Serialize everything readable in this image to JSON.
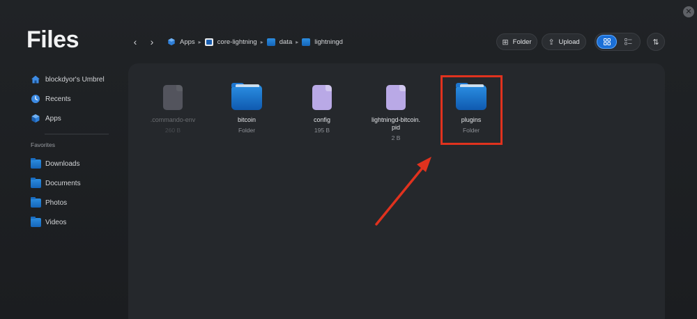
{
  "app": {
    "title": "Files"
  },
  "window": {
    "close_icon": "close-icon"
  },
  "sidebar": {
    "items": [
      {
        "label": "blockdyor's Umbrel",
        "icon": "home-icon"
      },
      {
        "label": "Recents",
        "icon": "clock-icon"
      },
      {
        "label": "Apps",
        "icon": "cube-icon"
      }
    ],
    "favorites_heading": "Favorites",
    "favorites": [
      {
        "label": "Downloads",
        "icon": "folder-icon"
      },
      {
        "label": "Documents",
        "icon": "folder-icon"
      },
      {
        "label": "Photos",
        "icon": "folder-icon"
      },
      {
        "label": "Videos",
        "icon": "folder-icon"
      }
    ]
  },
  "toolbar": {
    "back_icon": "chevron-left-icon",
    "forward_icon": "chevron-right-icon",
    "breadcrumb": [
      "Apps",
      "core-lightning",
      "data",
      "lightningd"
    ],
    "folder_button": "Folder",
    "upload_button": "Upload",
    "view_mode": "grid"
  },
  "files": [
    {
      "name": ".commando-env",
      "meta": "260 B",
      "kind": "file",
      "faded": true
    },
    {
      "name": "bitcoin",
      "meta": "Folder",
      "kind": "folder"
    },
    {
      "name": "config",
      "meta": "195 B",
      "kind": "file"
    },
    {
      "name": "lightningd-bitcoin.\npid",
      "meta": "2 B",
      "kind": "file"
    },
    {
      "name": "plugins",
      "meta": "Folder",
      "kind": "folder",
      "highlighted": true
    }
  ],
  "colors": {
    "accent": "#1b6fd6",
    "annotation": "#e0321e",
    "doc_icon": "#b9a9e6",
    "folder_icon": "#1f7ad6"
  }
}
